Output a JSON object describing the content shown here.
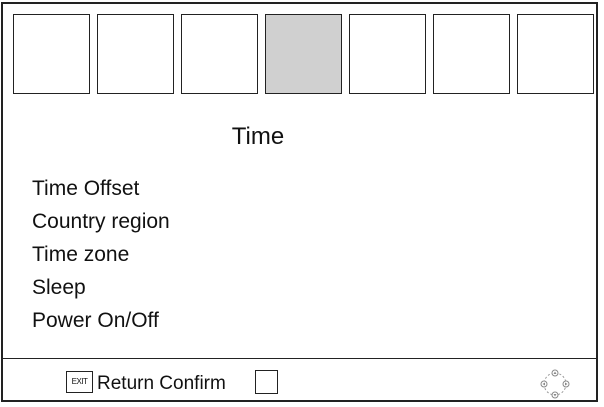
{
  "tabs": [
    {
      "label": "",
      "active": false
    },
    {
      "label": "",
      "active": false
    },
    {
      "label": "",
      "active": false
    },
    {
      "label": "",
      "active": true
    },
    {
      "label": "",
      "active": false
    },
    {
      "label": "",
      "active": false
    },
    {
      "label": "",
      "active": false
    }
  ],
  "page_title": "Time",
  "menu": {
    "items": [
      {
        "label": "Time Offset"
      },
      {
        "label": "Country region"
      },
      {
        "label": "Time zone"
      },
      {
        "label": "Sleep"
      },
      {
        "label": "Power On/Off"
      }
    ]
  },
  "footer": {
    "exit_key_label": "EXIT",
    "return_confirm_label": "Return Confirm",
    "nav_icon": "dpad-icon"
  },
  "colors": {
    "active_tab": "#d0d0d0",
    "border": "#222222",
    "background": "#ffffff"
  }
}
